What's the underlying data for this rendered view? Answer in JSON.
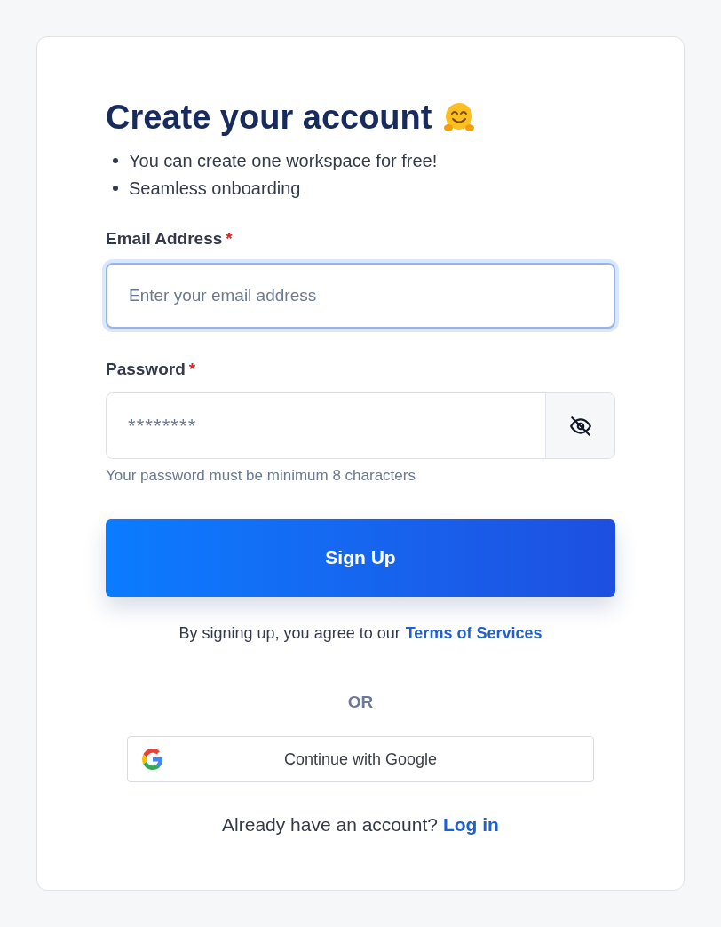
{
  "title": "Create your account",
  "bullets": [
    "You can create one workspace for free!",
    "Seamless onboarding"
  ],
  "fields": [
    {
      "kind": "email",
      "label": "Email Address",
      "required": true,
      "required_mark": "*",
      "placeholder": "Enter your email address",
      "focused": true
    },
    {
      "kind": "password",
      "label": "Password",
      "required": true,
      "required_mark": "*",
      "value": "********",
      "focused": false,
      "visible": false,
      "hint": "Your password must be minimum 8 characters"
    }
  ],
  "submit": "Sign Up",
  "terms": {
    "text": "By signing up, you agree to our",
    "link": "Terms of Services"
  },
  "divider": "OR",
  "google_button": "Continue with Google",
  "login": {
    "text": "Already have an account?",
    "link": "Log in"
  }
}
